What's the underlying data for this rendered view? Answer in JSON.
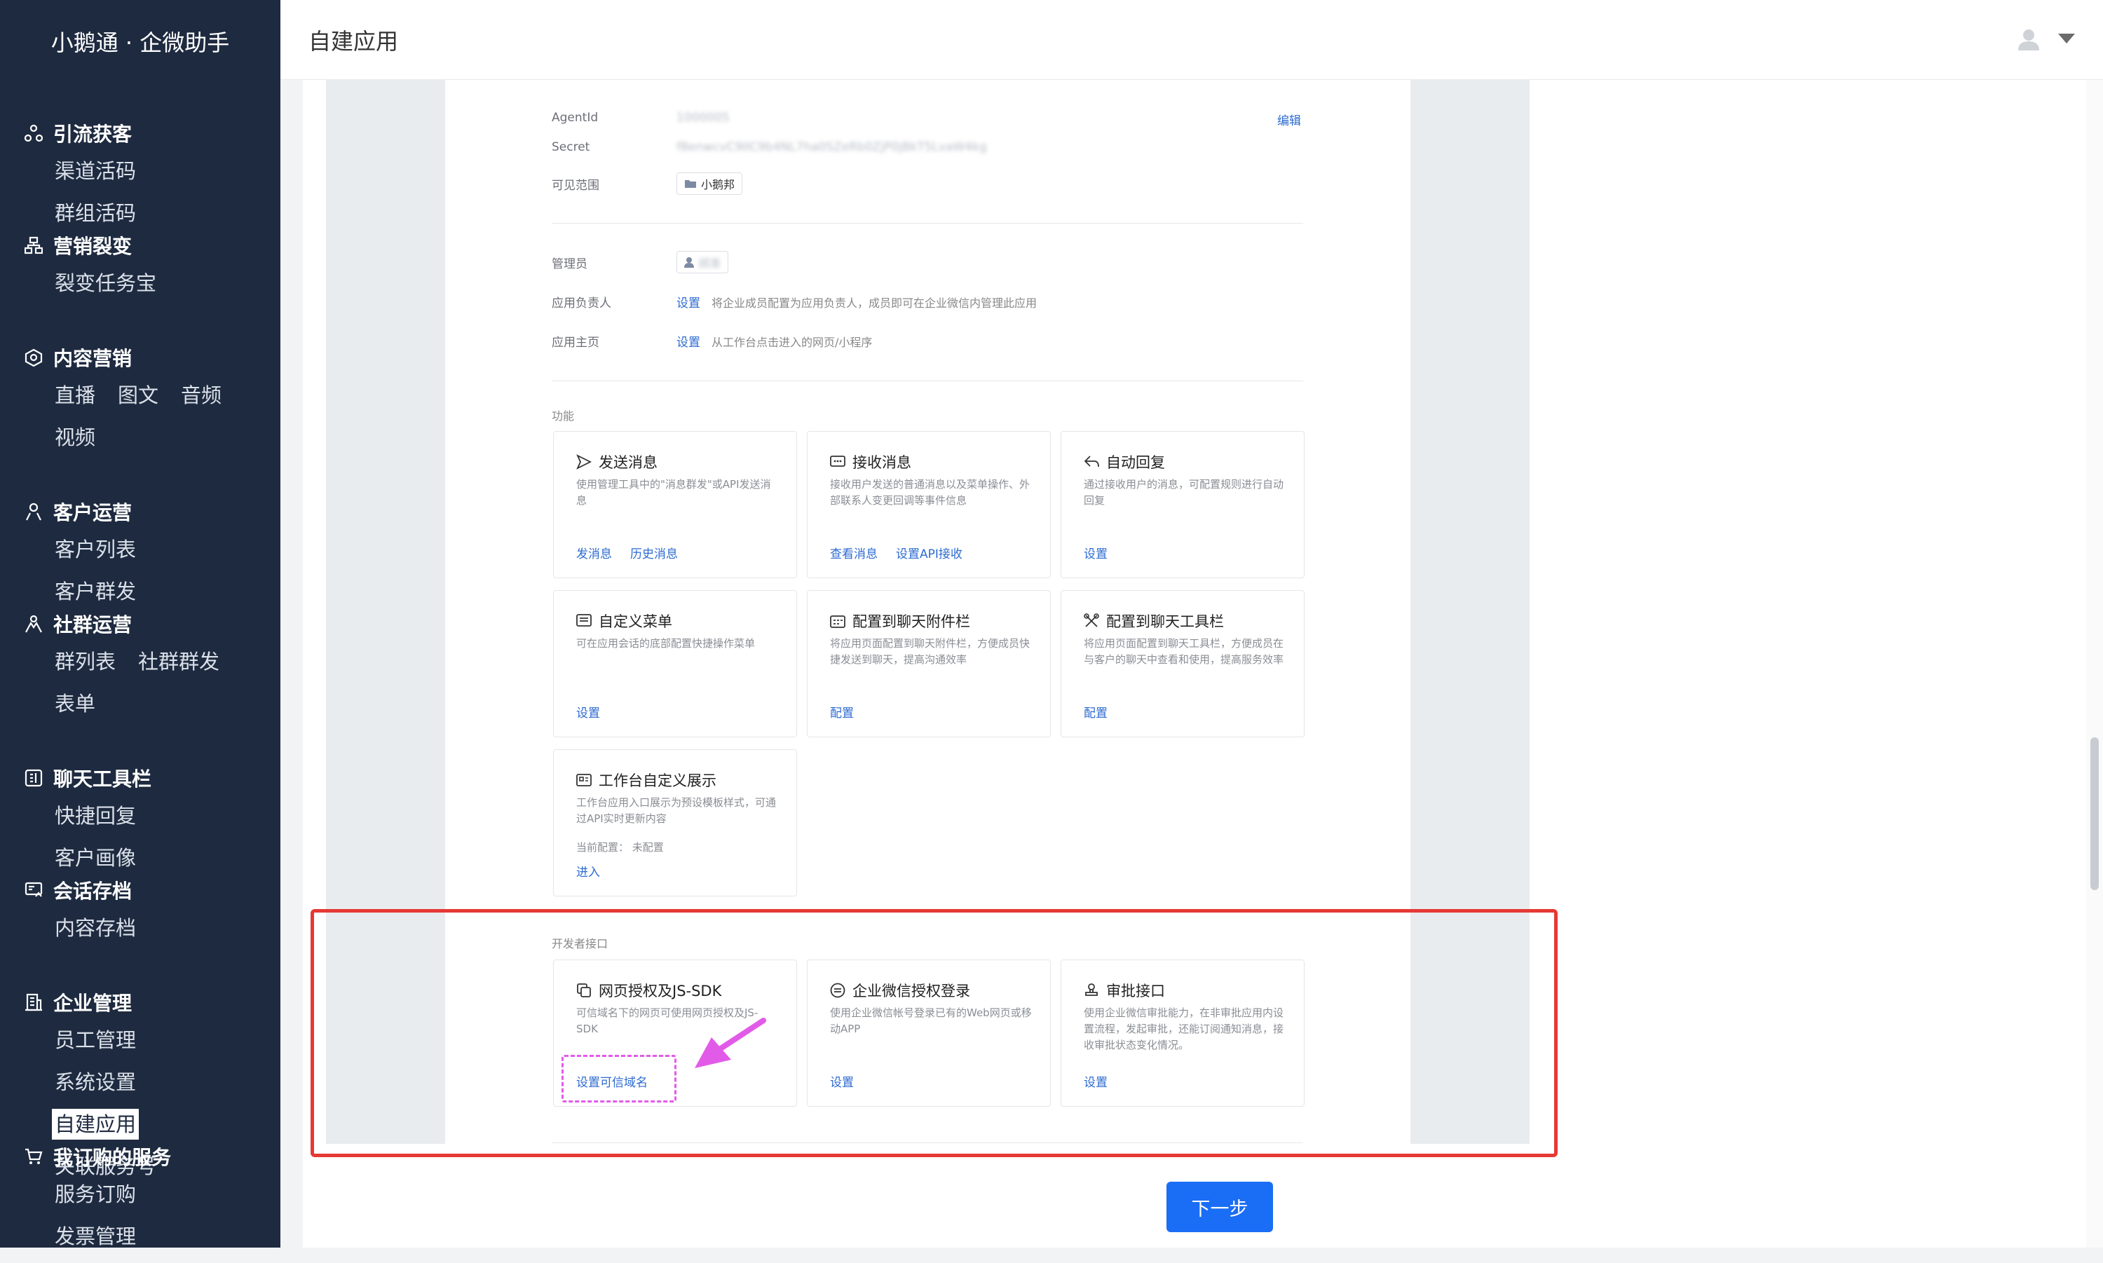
{
  "app": {
    "brand": "小鹅通 · 企微助手",
    "page_title": "自建应用"
  },
  "sidebar": {
    "groups": [
      {
        "title": "引流获客",
        "icon": "share-nodes-icon",
        "items": [
          "渠道活码",
          "群组活码"
        ]
      },
      {
        "title": "营销裂变",
        "icon": "org-chart-icon",
        "items": [
          "裂变任务宝"
        ]
      },
      {
        "title": "内容营销",
        "icon": "cube-icon",
        "items": [
          "直播",
          "图文",
          "音频",
          "视频"
        ]
      },
      {
        "title": "客户运营",
        "icon": "person-icon",
        "items": [
          "客户列表",
          "客户群发"
        ]
      },
      {
        "title": "社群运营",
        "icon": "people-icon",
        "items": [
          "群列表",
          "社群群发",
          "表单"
        ]
      },
      {
        "title": "聊天工具栏",
        "icon": "toolbar-icon",
        "items": [
          "快捷回复",
          "客户画像"
        ]
      },
      {
        "title": "会话存档",
        "icon": "archive-icon",
        "items": [
          "内容存档"
        ]
      },
      {
        "title": "企业管理",
        "icon": "building-icon",
        "items": [
          "员工管理",
          "系统设置",
          "自建应用",
          "关联服务号"
        ],
        "active": "自建应用"
      },
      {
        "title": "我订购的服务",
        "icon": "cart-icon",
        "items": [
          "服务订购",
          "发票管理"
        ]
      }
    ]
  },
  "app_info": {
    "agentid_label": "AgentId",
    "agentid_value": "1000005",
    "secret_label": "Secret",
    "secret_value": "f8enwcvC9IIC9b4NL7ha0SZeRb0ZjP0jBkT5LvaW4kg",
    "edit_link": "编辑",
    "visible_label": "可见范围",
    "visible_value": "小鹅邦",
    "admin_label": "管理员",
    "admin_value": "胡准",
    "owner_label": "应用负责人",
    "owner_link": "设置",
    "owner_desc": "将企业成员配置为应用负责人，成员即可在企业微信内管理此应用",
    "home_label": "应用主页",
    "home_link": "设置",
    "home_desc": "从工作台点击进入的网页/小程序"
  },
  "features": {
    "section_label": "功能",
    "cards": [
      {
        "title": "发送消息",
        "desc": "使用管理工具中的\"消息群发\"或API发送消息",
        "links": [
          "发消息",
          "历史消息"
        ]
      },
      {
        "title": "接收消息",
        "desc": "接收用户发送的普通消息以及菜单操作、外部联系人变更回调等事件信息",
        "links": [
          "查看消息",
          "设置API接收"
        ]
      },
      {
        "title": "自动回复",
        "desc": "通过接收用户的消息，可配置规则进行自动回复",
        "links": [
          "设置"
        ]
      },
      {
        "title": "自定义菜单",
        "desc": "可在应用会话的底部配置快捷操作菜单",
        "links": [
          "设置"
        ]
      },
      {
        "title": "配置到聊天附件栏",
        "desc": "将应用页面配置到聊天附件栏，方便成员快捷发送到聊天，提高沟通效率",
        "links": [
          "配置"
        ]
      },
      {
        "title": "配置到聊天工具栏",
        "desc": "将应用页面配置到聊天工具栏，方便成员在与客户的聊天中查看和使用，提高服务效率",
        "links": [
          "配置"
        ]
      },
      {
        "title": "工作台自定义展示",
        "desc": "工作台应用入口展示为预设模板样式，可通过API实时更新内容",
        "extra": "当前配置： 未配置",
        "links": [
          "进入"
        ]
      }
    ]
  },
  "developer": {
    "section_label": "开发者接口",
    "cards": [
      {
        "title": "网页授权及JS-SDK",
        "desc": "可信域名下的网页可使用网页授权及JS-SDK",
        "links": [
          "设置可信域名"
        ]
      },
      {
        "title": "企业微信授权登录",
        "desc": "使用企业微信帐号登录已有的Web网页或移动APP",
        "links": [
          "设置"
        ]
      },
      {
        "title": "审批接口",
        "desc": "使用企业微信审批能力，在非审批应用内设置流程，发起审批，还能订阅通知消息，接收审批状态变化情况。",
        "links": [
          "设置"
        ]
      }
    ]
  },
  "footer": {
    "next_button": "下一步"
  },
  "colors": {
    "sidebar_bg": "#1e2a3f",
    "link": "#2d6bd1",
    "primary_button": "#1a6ef5",
    "highlight_red": "#e53935",
    "highlight_pink": "#e25be8"
  }
}
